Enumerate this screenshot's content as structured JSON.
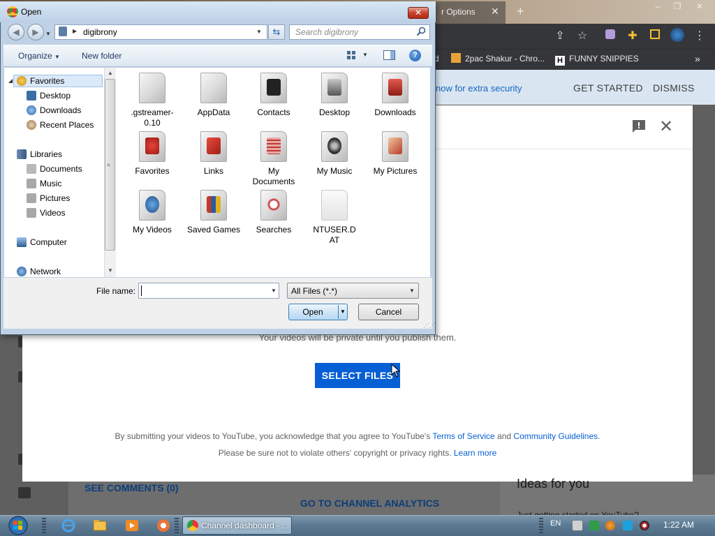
{
  "browser": {
    "tab_fragment": "r Options",
    "bookmarks": [
      {
        "label": "d"
      },
      {
        "label": "2pac Shakur - Chro..."
      },
      {
        "label": "FUNNY SNIPPIES"
      }
    ],
    "more_bookmarks": "»"
  },
  "youtube": {
    "banner_text": "now for extra security",
    "get_started": "GET STARTED",
    "dismiss": "DISMISS",
    "private_note": "Your videos will be private until you publish them.",
    "select_files": "SELECT FILES",
    "terms_prefix": "By submitting your videos to YouTube, you acknowledge that you agree to YouTube's ",
    "terms_link": "Terms of Service",
    "terms_and": " and ",
    "guidelines_link": "Community Guidelines",
    "terms_suffix": ".",
    "copyright_text": "Please be sure not to violate others' copyright or privacy rights. ",
    "learn_more": "Learn more",
    "see_comments": "SEE COMMENTS (0)",
    "channel_analytics": "GO TO CHANNEL ANALYTICS",
    "ideas_for_you": "Ideas for you",
    "getting_started": "Just getting started on YouTube?",
    "brand_color": "#065fd4"
  },
  "dialog": {
    "title": "Open",
    "address": "digibrony",
    "search_placeholder": "Search digibrony",
    "organize": "Organize",
    "new_folder": "New folder",
    "nav": {
      "favorites": "Favorites",
      "desktop": "Desktop",
      "downloads": "Downloads",
      "recent_places": "Recent Places",
      "libraries": "Libraries",
      "documents": "Documents",
      "music": "Music",
      "pictures": "Pictures",
      "videos": "Videos",
      "computer": "Computer",
      "network": "Network"
    },
    "files": [
      {
        "name": ".gstreamer-0.10",
        "icon": "folder-icon"
      },
      {
        "name": "AppData",
        "icon": "folder-icon"
      },
      {
        "name": "Contacts",
        "icon": "contacts-folder-icon"
      },
      {
        "name": "Desktop",
        "icon": "desktop-folder-icon"
      },
      {
        "name": "Downloads",
        "icon": "downloads-folder-icon"
      },
      {
        "name": "Favorites",
        "icon": "favorites-folder-icon"
      },
      {
        "name": "Links",
        "icon": "links-folder-icon"
      },
      {
        "name": "My Documents",
        "icon": "documents-folder-icon"
      },
      {
        "name": "My Music",
        "icon": "music-folder-icon"
      },
      {
        "name": "My Pictures",
        "icon": "pictures-folder-icon"
      },
      {
        "name": "My Videos",
        "icon": "videos-folder-icon"
      },
      {
        "name": "Saved Games",
        "icon": "games-folder-icon"
      },
      {
        "name": "Searches",
        "icon": "searches-folder-icon"
      },
      {
        "name": "NTUSER.DAT",
        "icon": "file-icon"
      }
    ],
    "file_name_label": "File name:",
    "file_name_value": "",
    "file_type": "All Files (*.*)",
    "open_button": "Open",
    "cancel_button": "Cancel"
  },
  "taskbar": {
    "chrome_task": "Channel dashboard - ...",
    "language": "EN",
    "time": "1:22 AM"
  }
}
